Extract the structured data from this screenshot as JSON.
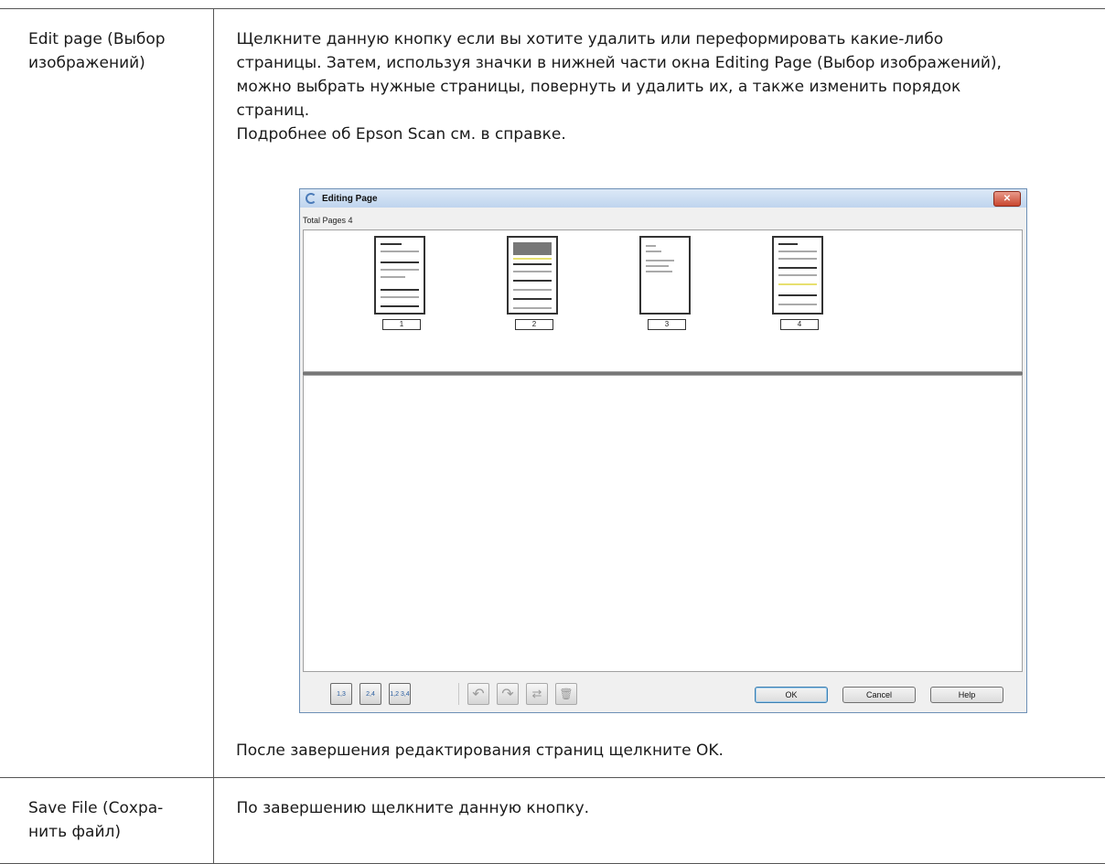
{
  "rows": [
    {
      "label": "Edit page (Выбор изображений)",
      "description": "Щелкните данную кнопку если вы хотите удалить или переформировать какие-либо\nстраницы. Затем, используя значки в нижней части окна Editing Page (Выбор изображений),\nможно выбрать нужные страницы, повернуть и удалить их, а также изменить порядок\nстраниц.\nПодробнее об Epson Scan см. в справке.",
      "after_text": "После завершения редактирования страниц щелкните OK."
    },
    {
      "label": "Save File (Сохра-\nнить файл)",
      "description": "По завершению щелкните данную кнопку."
    }
  ],
  "dialog": {
    "title": "Editing Page",
    "close_glyph": "✕",
    "total_pages": "Total Pages 4",
    "pages": [
      "1",
      "2",
      "3",
      "4"
    ],
    "toolbar_icons": [
      {
        "name": "select-odd-pages-icon",
        "glyph": "1,3"
      },
      {
        "name": "select-even-pages-icon",
        "glyph": "2,4"
      },
      {
        "name": "select-all-pages-icon",
        "glyph": "1,2 3,4"
      },
      {
        "name": "rotate-left-icon",
        "glyph": "↶"
      },
      {
        "name": "rotate-right-icon",
        "glyph": "↷"
      },
      {
        "name": "move-page-icon",
        "glyph": "⇄"
      },
      {
        "name": "delete-page-icon",
        "glyph": "🗑"
      }
    ],
    "buttons": {
      "ok": "OK",
      "cancel": "Cancel",
      "help": "Help"
    }
  }
}
